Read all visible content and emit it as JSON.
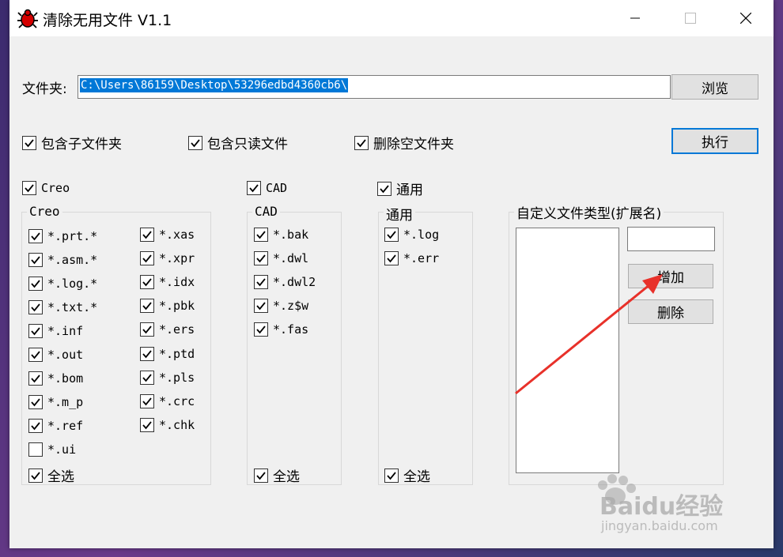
{
  "window": {
    "title": "清除无用文件  V1.1"
  },
  "folder": {
    "label": "文件夹:",
    "path": "C:\\Users\\86159\\Desktop\\53296edbd4360cb6\\",
    "browse_label": "浏览"
  },
  "options": [
    {
      "label": "包含子文件夹",
      "checked": true
    },
    {
      "label": "包含只读文件",
      "checked": true
    },
    {
      "label": "删除空文件夹",
      "checked": true
    }
  ],
  "execute_label": "执行",
  "creo": {
    "toggle_label": "Creo",
    "group_title": "Creo",
    "items_col1": [
      {
        "label": "*.prt.*",
        "checked": true
      },
      {
        "label": "*.asm.*",
        "checked": true
      },
      {
        "label": "*.log.*",
        "checked": true
      },
      {
        "label": "*.txt.*",
        "checked": true
      },
      {
        "label": "*.inf",
        "checked": true
      },
      {
        "label": "*.out",
        "checked": true
      },
      {
        "label": "*.bom",
        "checked": true
      },
      {
        "label": "*.m_p",
        "checked": true
      },
      {
        "label": "*.ref",
        "checked": true
      },
      {
        "label": "*.ui",
        "checked": false
      }
    ],
    "items_col2": [
      {
        "label": "*.xas",
        "checked": true
      },
      {
        "label": "*.xpr",
        "checked": true
      },
      {
        "label": "*.idx",
        "checked": true
      },
      {
        "label": "*.pbk",
        "checked": true
      },
      {
        "label": "*.ers",
        "checked": true
      },
      {
        "label": "*.ptd",
        "checked": true
      },
      {
        "label": "*.pls",
        "checked": true
      },
      {
        "label": "*.crc",
        "checked": true
      },
      {
        "label": "*.chk",
        "checked": true
      }
    ],
    "select_all_label": "全选"
  },
  "cad": {
    "toggle_label": "CAD",
    "group_title": "CAD",
    "items": [
      {
        "label": "*.bak",
        "checked": true
      },
      {
        "label": "*.dwl",
        "checked": true
      },
      {
        "label": "*.dwl2",
        "checked": true
      },
      {
        "label": "*.z$w",
        "checked": true
      },
      {
        "label": "*.fas",
        "checked": true
      }
    ],
    "select_all_label": "全选"
  },
  "general": {
    "toggle_label": "通用",
    "group_title": "通用",
    "items": [
      {
        "label": "*.log",
        "checked": true
      },
      {
        "label": "*.err",
        "checked": true
      }
    ],
    "select_all_label": "全选"
  },
  "custom": {
    "group_title": "自定义文件类型(扩展名)",
    "ext_value": "",
    "add_label": "增加",
    "delete_label": "删除"
  },
  "watermark": {
    "brand": "Baidu经验",
    "url": "jingyan.baidu.com"
  },
  "colors": {
    "selection": "#0078d7",
    "arrow": "#e8312a"
  }
}
